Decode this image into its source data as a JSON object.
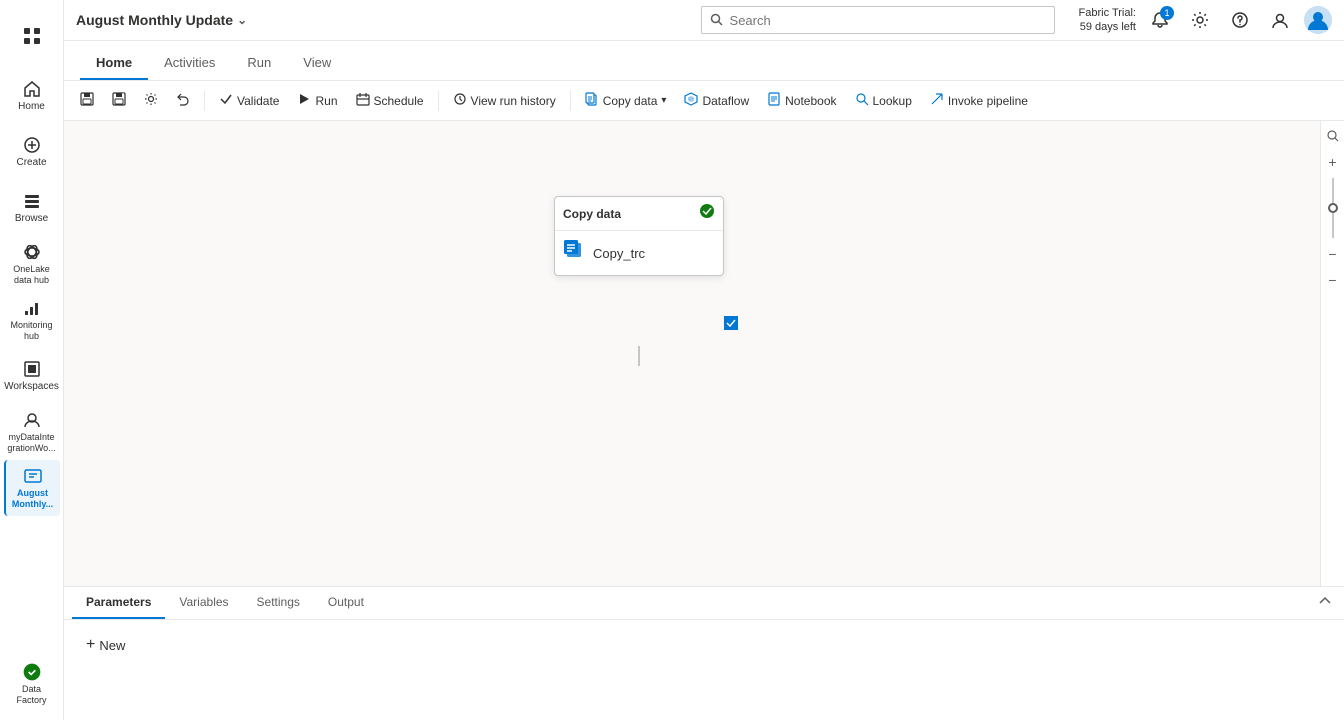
{
  "app": {
    "title": "August Monthly Update",
    "chevron": "⌄"
  },
  "search": {
    "placeholder": "Search"
  },
  "fabric_trial": {
    "line1": "Fabric Trial:",
    "line2": "59 days left"
  },
  "topbar_icons": {
    "notification": "🔔",
    "notification_count": "1",
    "settings": "⚙",
    "help": "?",
    "user": "👤"
  },
  "nav_tabs": [
    {
      "id": "home",
      "label": "Home",
      "active": true
    },
    {
      "id": "activities",
      "label": "Activities",
      "active": false
    },
    {
      "id": "run",
      "label": "Run",
      "active": false
    },
    {
      "id": "view",
      "label": "View",
      "active": false
    }
  ],
  "toolbar": {
    "items": [
      {
        "id": "save",
        "icon": "💾",
        "label": ""
      },
      {
        "id": "saveas",
        "icon": "📋",
        "label": ""
      },
      {
        "id": "settings",
        "icon": "⚙",
        "label": ""
      },
      {
        "id": "undo",
        "icon": "↩",
        "label": ""
      },
      {
        "id": "validate",
        "icon": "✓",
        "label": "Validate"
      },
      {
        "id": "run",
        "icon": "▶",
        "label": "Run"
      },
      {
        "id": "schedule",
        "icon": "📅",
        "label": "Schedule"
      },
      {
        "id": "view_run_history",
        "icon": "⏱",
        "label": "View run history"
      },
      {
        "id": "copy_data",
        "icon": "📄",
        "label": "Copy data",
        "has_dropdown": true
      },
      {
        "id": "dataflow",
        "icon": "⬡",
        "label": "Dataflow"
      },
      {
        "id": "notebook",
        "icon": "📓",
        "label": "Notebook"
      },
      {
        "id": "lookup",
        "icon": "🔍",
        "label": "Lookup"
      },
      {
        "id": "invoke_pipeline",
        "icon": "↗",
        "label": "Invoke pipeline"
      }
    ]
  },
  "pipeline_node": {
    "title": "Copy data",
    "status": "✓",
    "item_name": "Copy_trc"
  },
  "bottom_panel": {
    "tabs": [
      {
        "id": "parameters",
        "label": "Parameters",
        "active": true
      },
      {
        "id": "variables",
        "label": "Variables",
        "active": false
      },
      {
        "id": "settings",
        "label": "Settings",
        "active": false
      },
      {
        "id": "output",
        "label": "Output",
        "active": false
      }
    ],
    "new_btn_label": "New"
  },
  "sidebar": {
    "items": [
      {
        "id": "apps",
        "icon": "⊞",
        "label": ""
      },
      {
        "id": "home",
        "icon": "🏠",
        "label": "Home"
      },
      {
        "id": "create",
        "icon": "➕",
        "label": "Create"
      },
      {
        "id": "browse",
        "icon": "⬡",
        "label": "Browse"
      },
      {
        "id": "onelake",
        "icon": "🗄",
        "label": "OneLake\ndata hub"
      },
      {
        "id": "monitoring",
        "icon": "📊",
        "label": "Monitoring\nhub"
      },
      {
        "id": "workspaces",
        "icon": "⬜",
        "label": "Workspaces"
      },
      {
        "id": "mydata",
        "icon": "⚙",
        "label": "myDataInte\ngrationWo..."
      },
      {
        "id": "august",
        "icon": "📋",
        "label": "August\nMonthly...",
        "active": true
      }
    ],
    "bottom": {
      "id": "datafactory",
      "icon": "🌿",
      "label": "Data Factory"
    }
  },
  "zoom_controls": {
    "search_icon": "🔍",
    "plus": "+",
    "minus": "−",
    "dash": "−"
  }
}
